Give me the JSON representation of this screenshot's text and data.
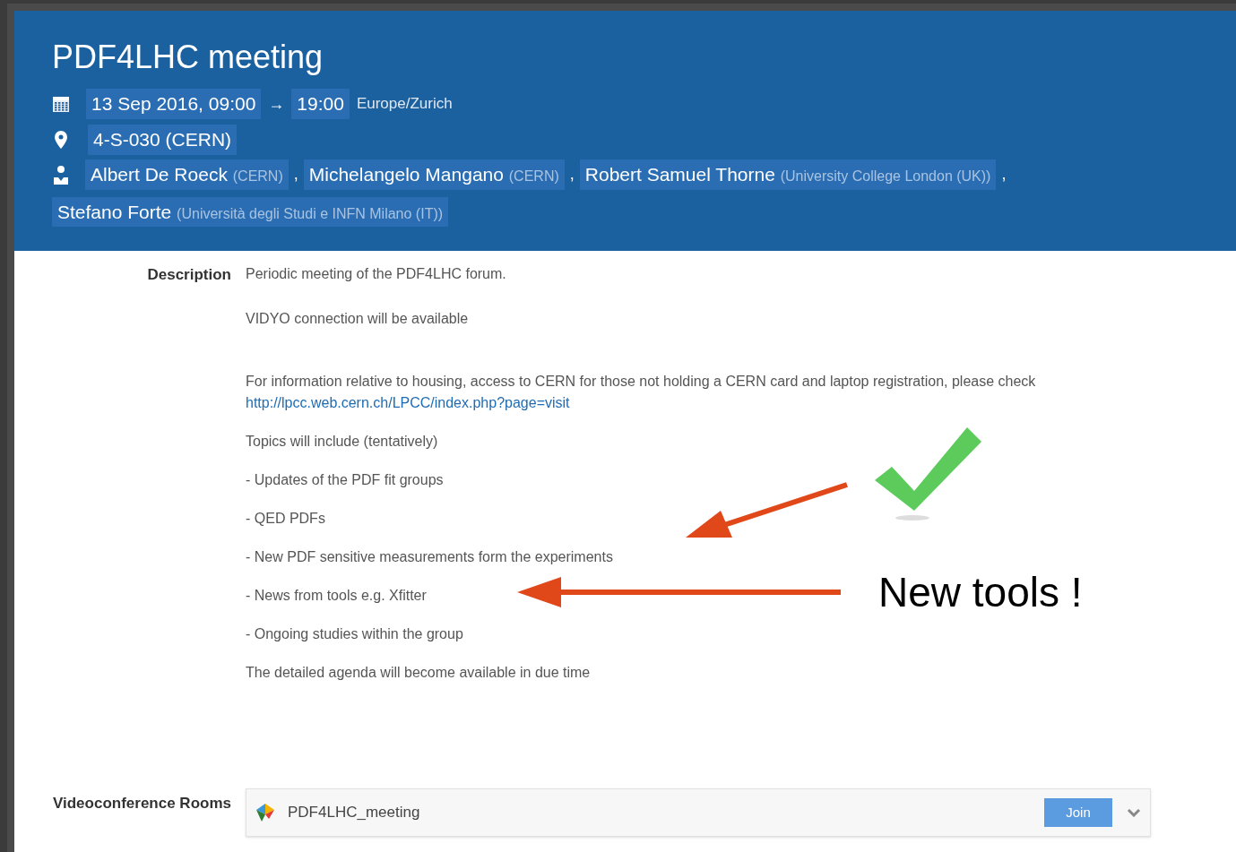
{
  "event": {
    "title": "PDF4LHC meeting",
    "start": "13 Sep 2016, 09:00",
    "arrow": "→",
    "end": "19:00",
    "timezone": "Europe/Zurich",
    "location": "4-S-030 (CERN)",
    "chairs": [
      {
        "name": "Albert De Roeck",
        "affiliation": "(CERN)"
      },
      {
        "name": "Michelangelo Mangano",
        "affiliation": "(CERN)"
      },
      {
        "name": "Robert Samuel Thorne",
        "affiliation": "(University College London (UK))"
      },
      {
        "name": "Stefano Forte",
        "affiliation": "(Università degli Studi e INFN Milano (IT))"
      }
    ],
    "separator": ","
  },
  "description": {
    "label": "Description",
    "paragraphs": [
      {
        "text": "Periodic meeting of the PDF4LHC forum."
      },
      {
        "text": "VIDYO connection will be available"
      },
      {
        "text": "For information relative to housing, access to CERN for those not holding a CERN card and laptop registration, please check",
        "link": "http://lpcc.web.cern.ch/LPCC/index.php?page=visit"
      },
      {
        "text": "Topics will include (tentatively)"
      },
      {
        "text": "- Updates of the PDF fit groups"
      },
      {
        "text": "- QED PDFs"
      },
      {
        "text": "- New PDF sensitive measurements form the experiments"
      },
      {
        "text": "- News from tools e.g. Xfitter"
      },
      {
        "text": "- Ongoing studies within the group"
      },
      {
        "text": "The detailed agenda will become available in due time"
      }
    ]
  },
  "videoconference": {
    "label": "Videoconference Rooms",
    "room": "PDF4LHC_meeting",
    "join": "Join"
  },
  "annotation": {
    "text": "New tools !"
  }
}
